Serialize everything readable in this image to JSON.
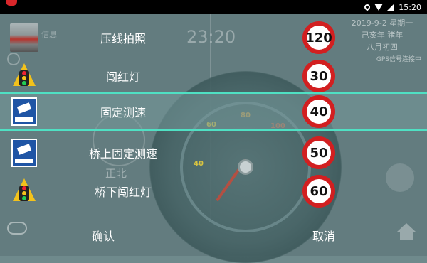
{
  "status_bar": {
    "time": "15:20"
  },
  "background": {
    "clock": "23:20",
    "info_text": "信息",
    "date_line1": "2019-9-2 星期一",
    "date_line2": "己亥年 猪年",
    "date_line3": "八月初四",
    "gps_status": "GPS信号连接中",
    "direction": "正北",
    "speedo_ticks": [
      "40",
      "60",
      "80",
      "100"
    ]
  },
  "dialog": {
    "items": [
      {
        "label": "压线拍照",
        "icon": "photo-thumb-icon",
        "speed": "120"
      },
      {
        "label": "闯红灯",
        "icon": "traffic-light-icon",
        "speed": "30"
      },
      {
        "label": "固定测速",
        "icon": "speed-camera-sign-icon",
        "speed": "40",
        "selected": true
      },
      {
        "label": "桥上固定测速",
        "icon": "speed-camera-sign-icon",
        "speed": "50"
      },
      {
        "label": "桥下闯红灯",
        "icon": "traffic-light-icon",
        "speed": "60"
      }
    ],
    "confirm_label": "确认",
    "cancel_label": "取消"
  },
  "colors": {
    "accent": "#4fe0c3",
    "sign_red": "#d21f20",
    "camera_blue": "#1f55a5",
    "traffic_yellow": "#f3c21b"
  }
}
